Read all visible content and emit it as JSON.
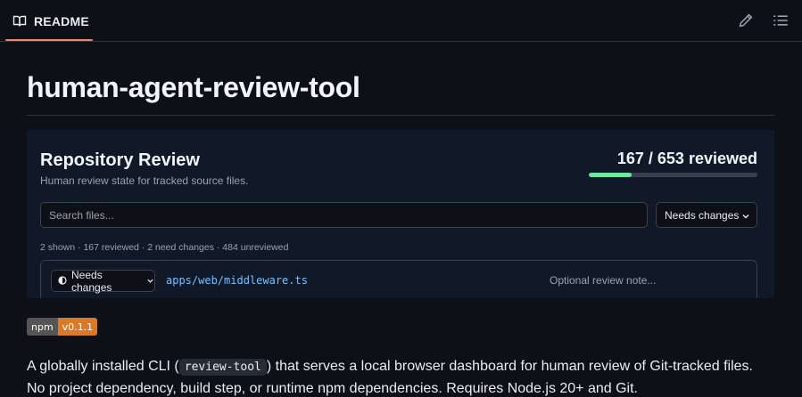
{
  "tab": {
    "label": "README",
    "icon": "book-icon"
  },
  "toolbar": {
    "edit_icon": "pencil-icon",
    "outline_icon": "list-icon"
  },
  "title": "human-agent-review-tool",
  "panel": {
    "title": "Repository Review",
    "subtitle": "Human review state for tracked source files.",
    "progress_text": "167 / 653 reviewed",
    "progress": {
      "reviewed": 167,
      "total": 653
    },
    "search_placeholder": "Search files...",
    "filter_value": "Needs changes",
    "summary": "2 shown · 167 reviewed · 2 need changes · 484 unreviewed",
    "file": {
      "status": "Needs changes",
      "path": "apps/web/middleware.ts",
      "note_placeholder": "Optional review note..."
    }
  },
  "badge": {
    "left": "npm",
    "right": "v0.1.1"
  },
  "description": {
    "before": "A globally installed CLI (",
    "code": "review-tool",
    "after": ") that serves a local browser dashboard for human review of Git-tracked files.",
    "line2": "No project dependency, build step, or runtime npm dependencies. Requires Node.js 20+ and Git."
  },
  "colors": {
    "accent_underline": "#f78166",
    "progress_fill": "#6ee7a0",
    "link": "#79c0ff",
    "badge_version": "#d97a2b"
  }
}
